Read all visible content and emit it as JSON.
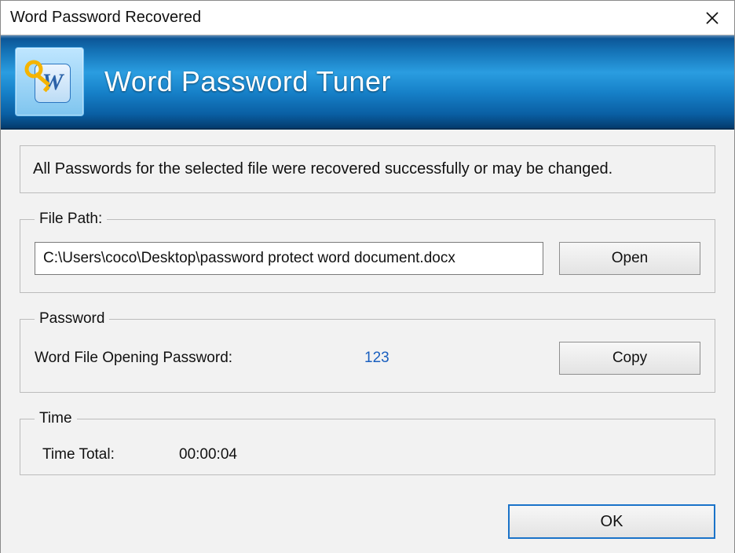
{
  "window": {
    "title": "Word Password Recovered"
  },
  "banner": {
    "title": "Word Password Tuner"
  },
  "message": "All Passwords for the selected file were recovered successfully or may be changed.",
  "file_path": {
    "legend": "File Path:",
    "value": "C:\\Users\\coco\\Desktop\\password protect word document.docx",
    "open_label": "Open"
  },
  "password": {
    "legend": "Password",
    "label": "Word File Opening Password:",
    "value": "123",
    "copy_label": "Copy"
  },
  "time": {
    "legend": "Time",
    "label": "Time Total:",
    "value": "00:00:04"
  },
  "ok_label": "OK"
}
